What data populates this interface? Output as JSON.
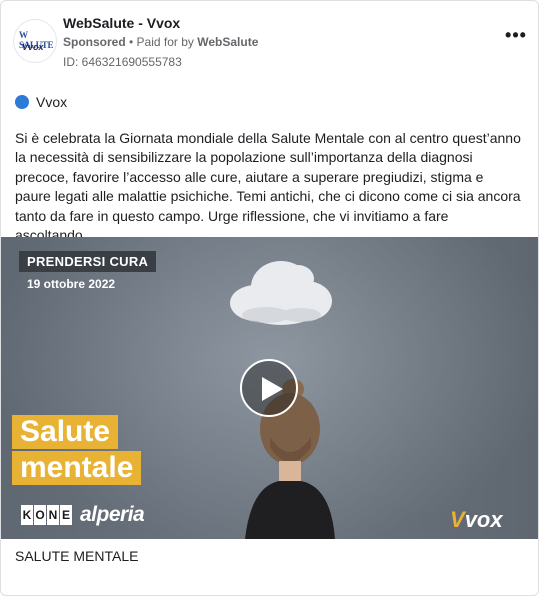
{
  "header": {
    "avatar_line1": "W SALUTE",
    "avatar_line2": "Vvox",
    "page_name": "WebSalute - Vvox",
    "sponsored": "Sponsored",
    "paid_for_prefix": " • Paid for by ",
    "paid_for_by": "WebSalute",
    "ad_id": "ID: 646321690555783",
    "more_label": "•••"
  },
  "platform": {
    "name": "Vvox",
    "dot_color": "#2d7bd6"
  },
  "body_text": "Si è celebrata la Giornata mondiale della Salute Mentale con al centro quest’anno la necessità di sensibilizzare la popolazione sull’importanza della diagnosi precoce, favorire l’accesso alle cure, aiutare a superare pregiudizi, stigma e paure legati alle malattie psichiche. Temi antichi, che ci dicono come ci sia ancora tanto da fare in questo campo. Urge riflessione, che vi invitiamo a fare ascoltando…",
  "media": {
    "tag": "PRENDERSI CURA",
    "date": "19 ottobre 2022",
    "title_line1": "Salute",
    "title_line2": "mentale",
    "sponsor1_letters": [
      "K",
      "O",
      "N",
      "E"
    ],
    "sponsor2": "alperia",
    "brand_v": "V",
    "brand_rest": "vox",
    "accent_color": "#e8b334"
  },
  "caption": "SALUTE MENTALE"
}
